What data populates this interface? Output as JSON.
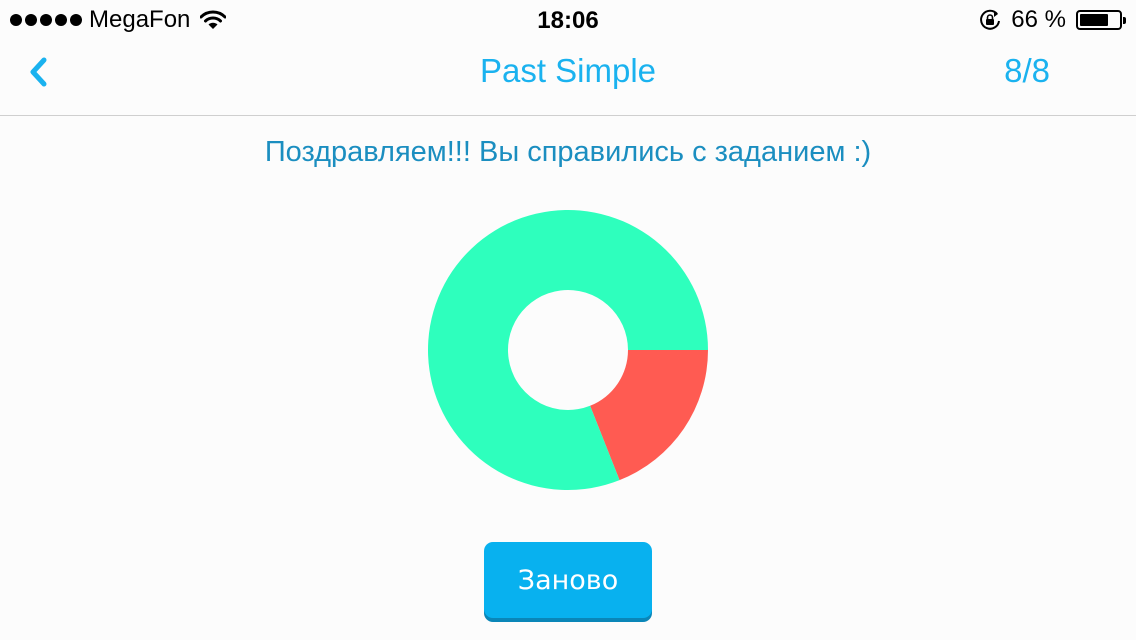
{
  "status_bar": {
    "carrier": "MegaFon",
    "time": "18:06",
    "battery_label": "66 %",
    "battery_level": 0.66,
    "signal_bars": 5
  },
  "nav": {
    "back_icon": "chevron-left-icon",
    "title": "Past Simple",
    "progress": "8/8"
  },
  "main": {
    "message": "Поздравляем!!! Вы справились с заданием :)",
    "retry_label": "Заново"
  },
  "colors": {
    "accent": "#1ab2ef",
    "message": "#1b8ec0",
    "correct": "#2effbd",
    "wrong": "#ff5b52",
    "button": "#08b1ef"
  },
  "chart_data": {
    "type": "pie",
    "categories": [
      "correct",
      "wrong"
    ],
    "values": [
      81,
      19
    ]
  }
}
